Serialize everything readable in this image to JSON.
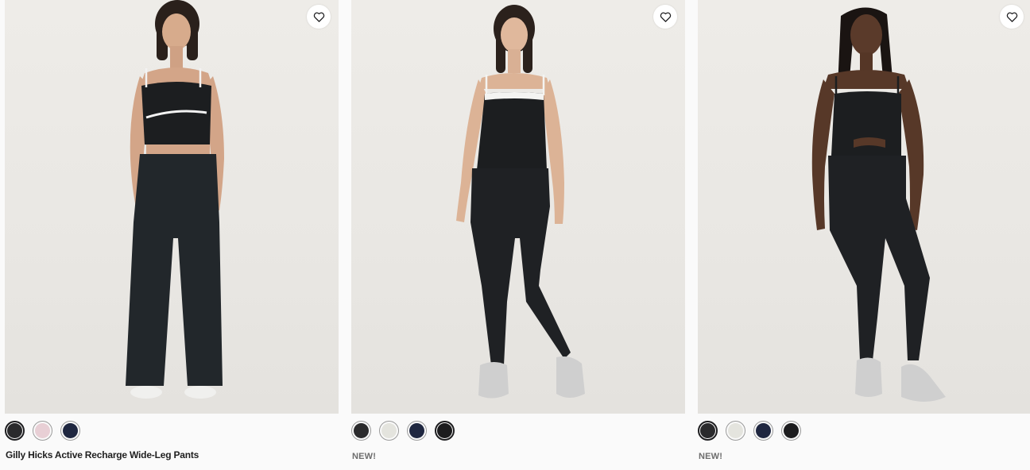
{
  "colors": {
    "page_bg": "#fafafa",
    "photo_bg": "#ebe9e5",
    "outfit_black": "#1c1e20",
    "badge_gray": "#6d6d6d"
  },
  "products": [
    {
      "image_alt": "Model wearing black cropped tank with white trim and black wide-leg pants",
      "favorite_icon": "heart-outline-icon",
      "swatches": [
        {
          "color": "#2a2a2c",
          "selected": true
        },
        {
          "color": "#e8cfd5",
          "selected": false
        },
        {
          "color": "#1f2740",
          "selected": false
        }
      ],
      "title": "Gilly Hicks Active Recharge Wide-Leg Pants"
    },
    {
      "image_alt": "Model wearing black tank with white trim and black leggings",
      "favorite_icon": "heart-outline-icon",
      "swatches": [
        {
          "color": "#2a2a2c",
          "selected": false
        },
        {
          "color": "#e4e4de",
          "selected": false
        },
        {
          "color": "#1f2740",
          "selected": false
        },
        {
          "color": "#1c1c1e",
          "selected": true
        }
      ],
      "badge": "NEW!"
    },
    {
      "image_alt": "Model wearing black camisole and black leggings",
      "favorite_icon": "heart-outline-icon",
      "swatches": [
        {
          "color": "#2a2a2c",
          "selected": true
        },
        {
          "color": "#e4e4de",
          "selected": false
        },
        {
          "color": "#1f2740",
          "selected": false
        },
        {
          "color": "#1c1c1e",
          "selected": false
        }
      ],
      "badge": "NEW!"
    }
  ]
}
